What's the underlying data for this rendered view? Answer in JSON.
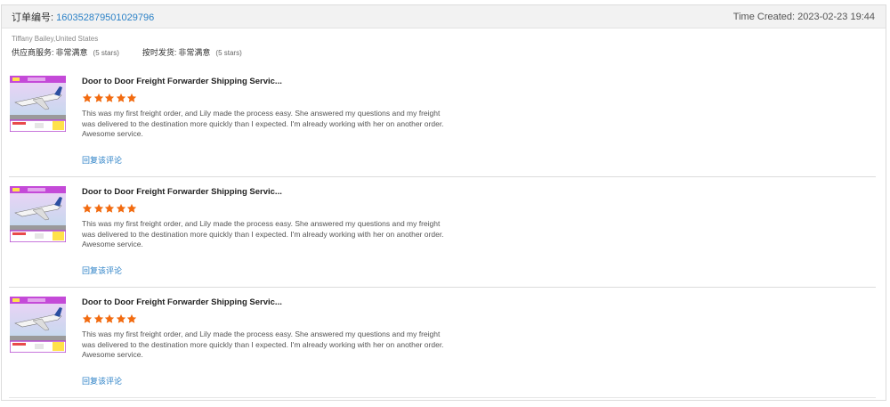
{
  "order": {
    "label": "订单编号:",
    "number": "160352879501029796",
    "time_created": "Time Created: 2023-02-23 19:44"
  },
  "buyer": {
    "name": "Tiffany Bailey,United States",
    "ratings": [
      {
        "label": "供应商服务:",
        "value": "非常满意",
        "stars_text": "(5 stars)"
      },
      {
        "label": "按时发货:",
        "value": "非常满意",
        "stars_text": "(5 stars)"
      }
    ]
  },
  "colors": {
    "link": "#2d82c7",
    "star": "#f26b10"
  },
  "reviews": [
    {
      "title": "Door to Door Freight Forwarder Shipping Servic...",
      "stars": 5,
      "text": "This was my first freight order, and Lily made the process easy. She answered my questions and my freight was delivered to the destination more quickly than I expected. I'm already working with her on another order. Awesome service.",
      "reply": "回复该评论",
      "thumbnail_icon": "airplane-thumbnail"
    },
    {
      "title": "Door to Door Freight Forwarder Shipping Servic...",
      "stars": 5,
      "text": "This was my first freight order, and Lily made the process easy. She answered my questions and my freight was delivered to the destination more quickly than I expected. I'm already working with her on another order. Awesome service.",
      "reply": "回复该评论",
      "thumbnail_icon": "airplane-thumbnail"
    },
    {
      "title": "Door to Door Freight Forwarder Shipping Servic...",
      "stars": 5,
      "text": "This was my first freight order, and Lily made the process easy. She answered my questions and my freight was delivered to the destination more quickly than I expected. I'm already working with her on another order. Awesome service.",
      "reply": "回复该评论",
      "thumbnail_icon": "airplane-thumbnail"
    }
  ]
}
